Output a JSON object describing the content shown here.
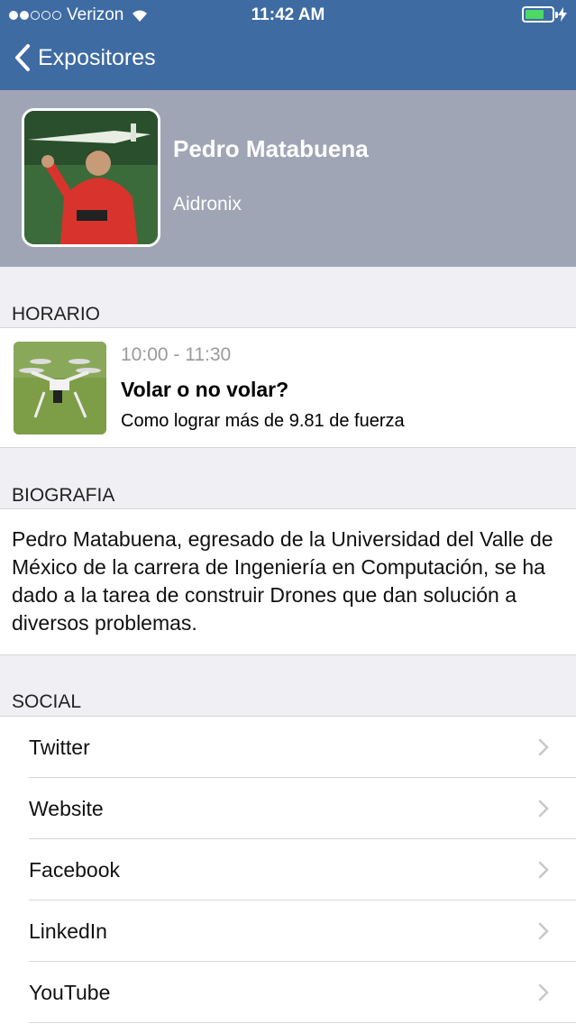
{
  "status_bar": {
    "carrier": "Verizon",
    "time": "11:42 AM",
    "signal_icon": "signal-dots-icon",
    "wifi_icon": "wifi-icon",
    "battery_icon": "battery-icon",
    "battery_color": "#4cd964",
    "battery_level": 0.7
  },
  "nav": {
    "back_label": "Expositores",
    "back_icon": "chevron-left-icon",
    "bar_color": "#3f6ba3"
  },
  "profile": {
    "name": "Pedro Matabuena",
    "company": "Aidronix",
    "photo_icon": "speaker-photo"
  },
  "sections": {
    "schedule": "HORARIO",
    "biography": "BIOGRAFIA",
    "social": "SOCIAL"
  },
  "event": {
    "time": "10:00 - 11:30",
    "title": "Volar o no volar?",
    "subtitle": "Como lograr más de 9.81 de fuerza",
    "thumb_icon": "drone-photo"
  },
  "bio": {
    "text": "Pedro Matabuena, egresado de la Universidad del Valle de México de la carrera de Ingeniería en Computación, se ha dado a la tarea de construir Drones que dan solución a diversos problemas."
  },
  "social": {
    "items": [
      {
        "label": "Twitter"
      },
      {
        "label": "Website"
      },
      {
        "label": "Facebook"
      },
      {
        "label": "LinkedIn"
      },
      {
        "label": "YouTube"
      }
    ],
    "chevron_icon": "chevron-right-icon"
  }
}
